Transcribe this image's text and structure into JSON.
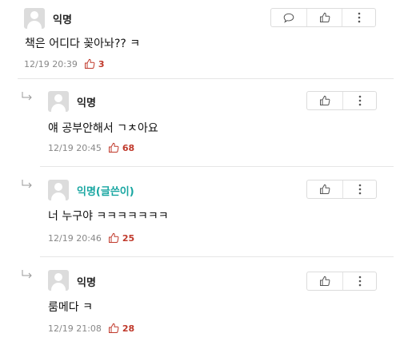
{
  "comments": [
    {
      "author": "익명",
      "text": "책은 어디다 꽂아놔?? ㅋ",
      "time": "12/19 20:39",
      "likes": "3"
    },
    {
      "author": "익명",
      "text": "얘 공부안해서 ㄱㅊ아요",
      "time": "12/19 20:45",
      "likes": "68"
    },
    {
      "author": "익명(글쓴이)",
      "text": "너 누구야 ㅋㅋㅋㅋㅋㅋㅋ",
      "time": "12/19 20:46",
      "likes": "25"
    },
    {
      "author": "익명",
      "text": "룸메다 ㅋ",
      "time": "12/19 21:08",
      "likes": "28"
    }
  ],
  "colors": {
    "writer": "#18a6a1",
    "like": "#c0392b",
    "meta": "#888888"
  },
  "icons": {
    "reply": "speech-bubble-icon",
    "like": "thumbs-up-icon",
    "more": "vertical-ellipsis-icon",
    "reply_marker": "reply-arrow-icon"
  }
}
